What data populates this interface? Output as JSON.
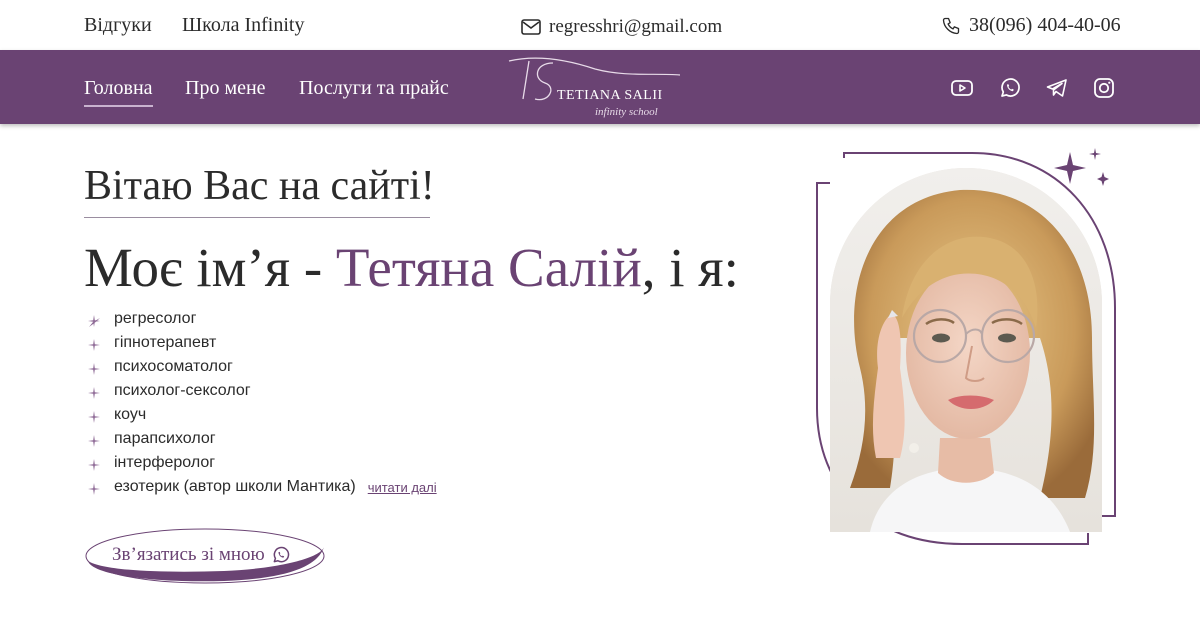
{
  "topbar": {
    "links": [
      "Відгуки",
      "Школа Infinity"
    ],
    "email": "regresshri@gmail.com",
    "phone": "38(096) 404-40-06"
  },
  "nav": {
    "items": [
      {
        "label": "Головна",
        "active": true
      },
      {
        "label": "Про мене",
        "active": false
      },
      {
        "label": "Послуги та прайс",
        "active": false
      }
    ],
    "logo": {
      "monogram": "TS",
      "name": "TETIANA SALII",
      "tagline": "infinity school"
    },
    "social_icons": [
      "youtube-icon",
      "whatsapp-icon",
      "telegram-icon",
      "instagram-icon"
    ]
  },
  "hero": {
    "greeting": "Вітаю Вас на сайті!",
    "name_prefix": "Моє ім’я - ",
    "name": "Тетяна Салій",
    "name_suffix": ", і я:",
    "roles": [
      "регресолог",
      "гіпнотерапевт",
      "психосоматолог",
      "психолог-сексолог",
      "коуч",
      "парапсихолог",
      "інтерферолог",
      "езотерик (автор школи Мантика)"
    ],
    "read_more": "читати далі",
    "cta_label": "Зв’язатись зі мною"
  },
  "colors": {
    "brand": "#6a4373",
    "text": "#2b2b2b",
    "background": "#ffffff",
    "star": "#8e6a96"
  }
}
